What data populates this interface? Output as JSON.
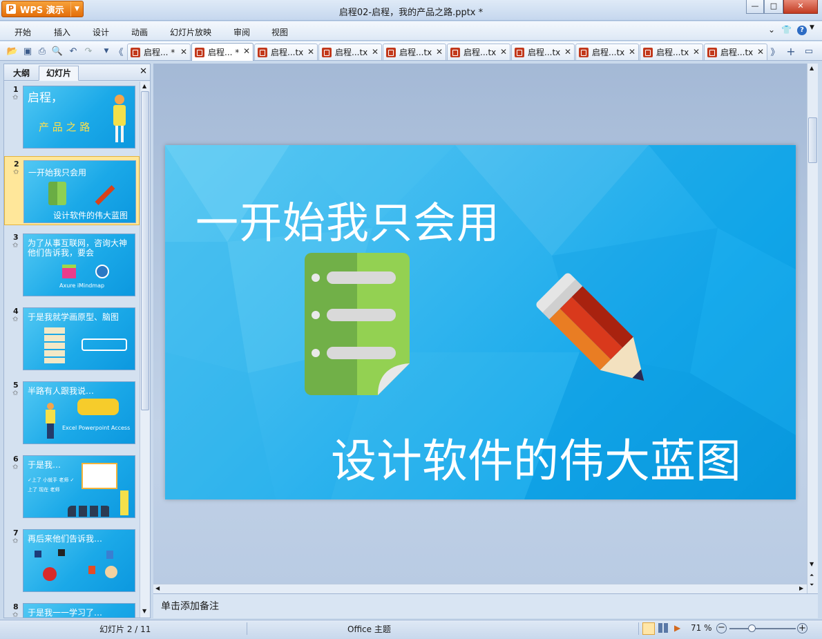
{
  "app": {
    "button_label": "WPS 演示",
    "window_title": "启程02-启程，我的产品之路.pptx *"
  },
  "window_controls": {
    "minimize": "—",
    "maximize": "□",
    "close": "✕"
  },
  "menu": [
    "开始",
    "插入",
    "设计",
    "动画",
    "幻灯片放映",
    "审阅",
    "视图"
  ],
  "menu_right": {
    "collapse": "⌄",
    "skin": "👕",
    "help": "?"
  },
  "tabs": [
    {
      "label": "启程... *",
      "active": false
    },
    {
      "label": "启程... *",
      "active": true
    },
    {
      "label": "启程...tx",
      "active": false
    },
    {
      "label": "启程...tx",
      "active": false
    },
    {
      "label": "启程...tx",
      "active": false
    },
    {
      "label": "启程...tx",
      "active": false
    },
    {
      "label": "启程...tx",
      "active": false
    },
    {
      "label": "启程...tx",
      "active": false
    },
    {
      "label": "启程...tx",
      "active": false
    },
    {
      "label": "启程...tx",
      "active": false
    }
  ],
  "left_pane": {
    "tab_outline": "大纲",
    "tab_slides": "幻灯片",
    "close": "✕",
    "thumbnails": [
      {
        "num": "1",
        "title": "启程，",
        "sub": "产 品 之 路",
        "selected": false
      },
      {
        "num": "2",
        "title": "一开始我只会用",
        "sub": "设计软件的伟大蓝图",
        "selected": true
      },
      {
        "num": "3",
        "title": "为了从事互联网，咨询大神他们告诉我，要会",
        "sub": "Axure   iMindmap",
        "selected": false
      },
      {
        "num": "4",
        "title": "于是我就学画原型、脑图",
        "sub": "",
        "selected": false
      },
      {
        "num": "5",
        "title": "半路有人跟我说…",
        "sub": "Excel  Powerpoint  Access",
        "selected": false
      },
      {
        "num": "6",
        "title": "于是我…",
        "sub": "✓上了 小就手 老师  ✓上了 现在 老师",
        "selected": false
      },
      {
        "num": "7",
        "title": "再后来他们告诉我…",
        "sub": "",
        "selected": false
      },
      {
        "num": "8",
        "title": "于是我一一学习了…",
        "sub": "",
        "selected": false
      }
    ]
  },
  "slide": {
    "title": "一开始我只会用",
    "subtitle": "设计软件的伟大蓝图"
  },
  "notes": {
    "placeholder": "单击添加备注"
  },
  "status": {
    "slide_info": "幻灯片 2 / 11",
    "theme": "Office 主题",
    "zoom": "71 %"
  }
}
